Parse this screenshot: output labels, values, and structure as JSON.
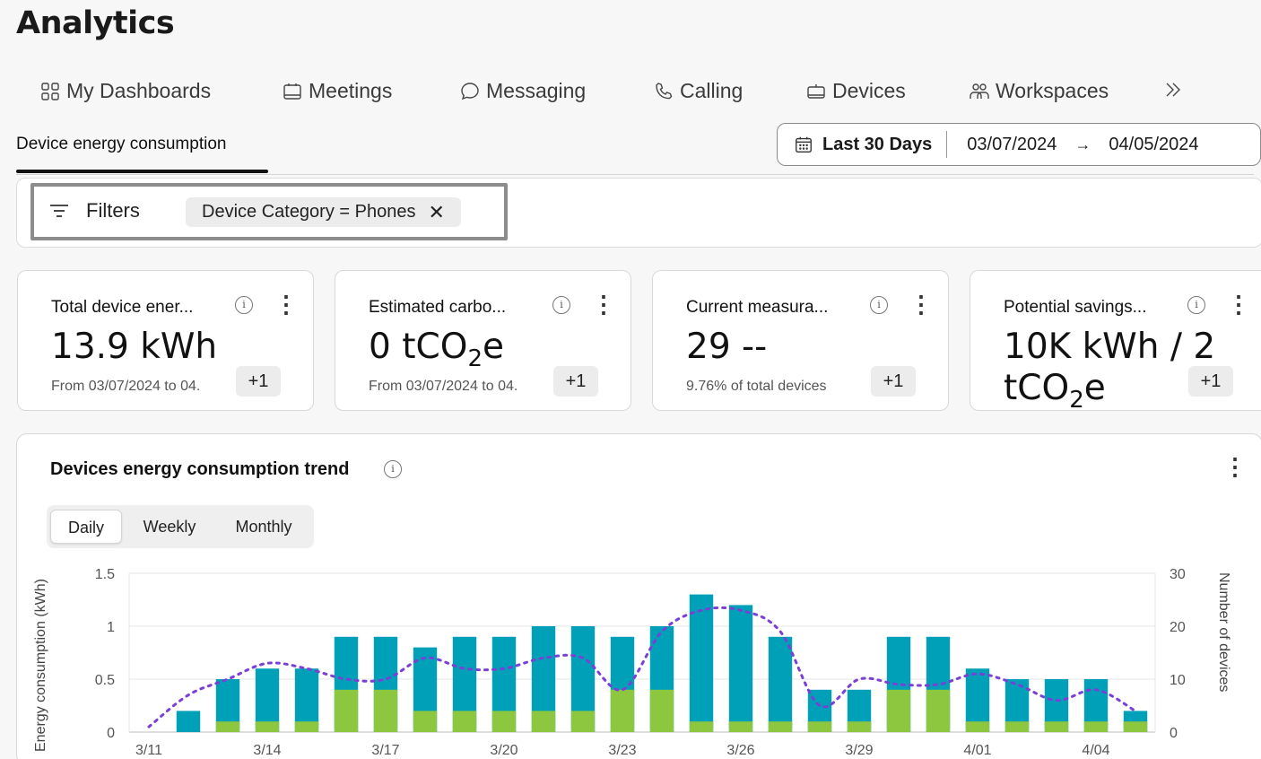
{
  "page": {
    "title": "Analytics"
  },
  "nav": {
    "tabs": [
      {
        "label": "My Dashboards",
        "icon": "dashboard-icon"
      },
      {
        "label": "Meetings",
        "icon": "meetings-icon"
      },
      {
        "label": "Messaging",
        "icon": "messaging-icon"
      },
      {
        "label": "Calling",
        "icon": "phone-icon"
      },
      {
        "label": "Devices",
        "icon": "devices-icon"
      },
      {
        "label": "Workspaces",
        "icon": "workspaces-icon"
      }
    ],
    "overflow_icon": "chevron-double-right-icon"
  },
  "subtab": {
    "label": "Device energy consumption"
  },
  "date_range": {
    "preset": "Last 30 Days",
    "start": "03/07/2024",
    "arrow": "→",
    "end": "04/05/2024"
  },
  "filters": {
    "label": "Filters",
    "chip": "Device Category = Phones",
    "chip_close": "✕"
  },
  "cards": [
    {
      "title": "Total device ener...",
      "value": "13.9 kWh",
      "sub": "From 03/07/2024 to 04.",
      "badge": "+1"
    },
    {
      "title": "Estimated carbo...",
      "value_main": "0 tCO",
      "value_sub": "2",
      "value_tail": "e",
      "sub": "From 03/07/2024 to 04.",
      "badge": "+1"
    },
    {
      "title": "Current measura...",
      "value": "29 --",
      "sub": "9.76% of total devices",
      "badge": "+1"
    },
    {
      "title": "Potential savings...",
      "value_line1": "10K kWh / 2",
      "value_line2_main": "tCO",
      "value_line2_sub": "2",
      "value_line2_tail": "e",
      "badge": "+1"
    }
  ],
  "chart_card": {
    "title": "Devices energy consumption trend",
    "toggle": {
      "options": [
        "Daily",
        "Weekly",
        "Monthly"
      ],
      "selected": "Daily"
    }
  },
  "chart_data": {
    "type": "bar",
    "stacked": true,
    "ylabel": "Energy consumption (kWh)",
    "y2label": "Number of devices",
    "ylim": [
      0,
      1.5
    ],
    "y2lim": [
      0,
      30
    ],
    "yticks": [
      "0",
      "0.5",
      "1",
      "1.5"
    ],
    "y2ticks": [
      "0",
      "10",
      "20",
      "30"
    ],
    "x_tick_labels": [
      "3/11",
      "3/14",
      "3/17",
      "3/20",
      "3/23",
      "3/26",
      "3/29",
      "4/01",
      "4/04"
    ],
    "x": [
      "3/11",
      "3/12",
      "3/13",
      "3/14",
      "3/15",
      "3/16",
      "3/17",
      "3/18",
      "3/19",
      "3/20",
      "3/21",
      "3/22",
      "3/23",
      "3/24",
      "3/25",
      "3/26",
      "3/27",
      "3/28",
      "3/29",
      "3/30",
      "3/31",
      "4/01",
      "4/02",
      "4/03",
      "4/04",
      "4/05"
    ],
    "colors": {
      "bar_total": "#00a0b8",
      "bar_green": "#8dc63f",
      "line": "#7b3fd6"
    },
    "series": [
      {
        "values": [
          0,
          0.2,
          0.5,
          0.6,
          0.6,
          0.9,
          0.9,
          0.8,
          0.9,
          0.9,
          1.0,
          1.0,
          0.9,
          1.0,
          1.3,
          1.2,
          0.9,
          0.4,
          0.4,
          0.9,
          0.9,
          0.6,
          0.5,
          0.5,
          0.5,
          0.2
        ]
      },
      {
        "values": [
          0,
          0,
          0.1,
          0.1,
          0.1,
          0.4,
          0.4,
          0.2,
          0.2,
          0.2,
          0.2,
          0.2,
          0.4,
          0.4,
          0.1,
          0.1,
          0.1,
          0.1,
          0.1,
          0.4,
          0.4,
          0.1,
          0.1,
          0.1,
          0.1,
          0.1
        ]
      },
      {
        "type": "line",
        "axis": "y2",
        "values": [
          1,
          7,
          10,
          13,
          12,
          10,
          10,
          14,
          12,
          12,
          14,
          14,
          8,
          19,
          23,
          23,
          19,
          5,
          10,
          9,
          9,
          11,
          9,
          6,
          8,
          4
        ]
      }
    ]
  }
}
